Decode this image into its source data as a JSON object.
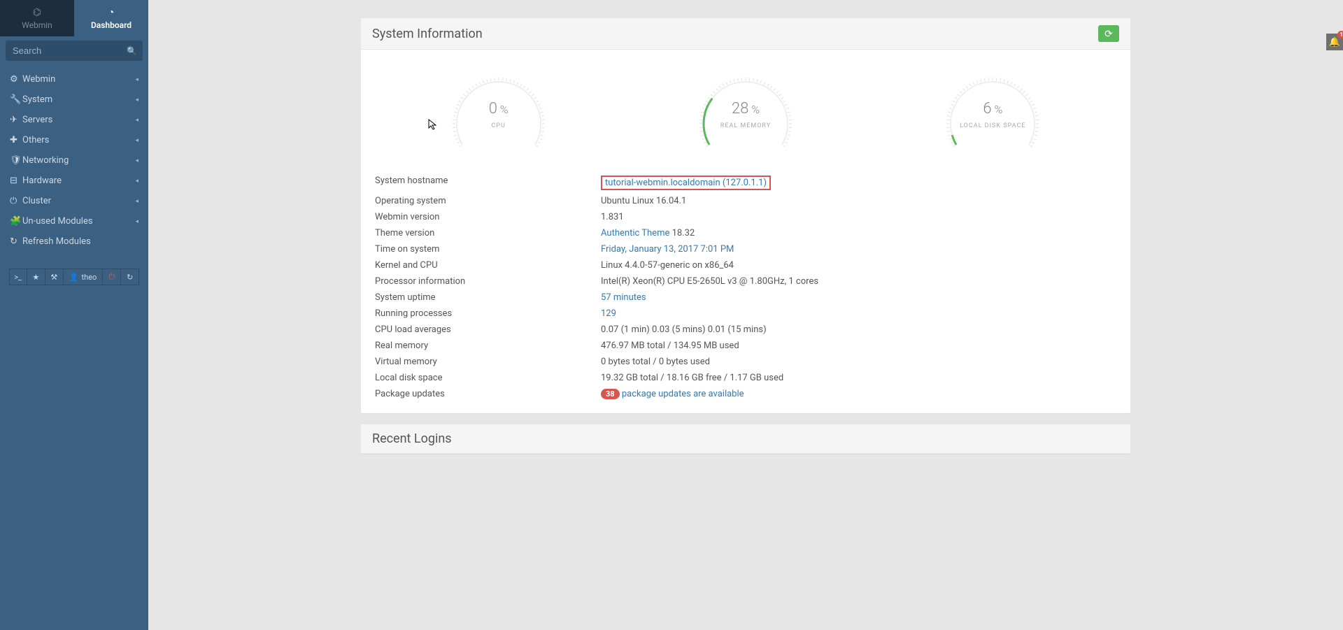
{
  "tabs": {
    "webmin": "Webmin",
    "dashboard": "Dashboard"
  },
  "search": {
    "placeholder": "Search"
  },
  "nav": [
    {
      "icon": "⚙",
      "label": "Webmin"
    },
    {
      "icon": "🔧",
      "label": "System"
    },
    {
      "icon": "✈",
      "label": "Servers"
    },
    {
      "icon": "✚",
      "label": "Others"
    },
    {
      "icon": "🛡",
      "label": "Networking"
    },
    {
      "icon": "⊟",
      "label": "Hardware"
    },
    {
      "icon": "⏻",
      "label": "Cluster"
    },
    {
      "icon": "🧩",
      "label": "Un-used Modules"
    },
    {
      "icon": "↻",
      "label": "Refresh Modules",
      "nocaret": true
    }
  ],
  "bottom": {
    "user": "theo"
  },
  "panels": {
    "sysinfo": {
      "title": "System Information"
    },
    "recent": {
      "title": "Recent Logins"
    }
  },
  "gauges": [
    {
      "value": 0,
      "label": "CPU"
    },
    {
      "value": 28,
      "label": "REAL MEMORY"
    },
    {
      "value": 6,
      "label": "LOCAL DISK SPACE"
    }
  ],
  "info": [
    {
      "label": "System hostname",
      "value": "tutorial-webmin.localdomain (127.0.1.1)",
      "link": true,
      "boxed": true
    },
    {
      "label": "Operating system",
      "value": "Ubuntu Linux 16.04.1"
    },
    {
      "label": "Webmin version",
      "value": "1.831"
    },
    {
      "label": "Theme version",
      "value_link": "Authentic Theme",
      "value_suffix": " 18.32"
    },
    {
      "label": "Time on system",
      "value": "Friday, January 13, 2017 7:01 PM",
      "link": true
    },
    {
      "label": "Kernel and CPU",
      "value": "Linux 4.4.0-57-generic on x86_64"
    },
    {
      "label": "Processor information",
      "value": "Intel(R) Xeon(R) CPU E5-2650L v3 @ 1.80GHz, 1 cores"
    },
    {
      "label": "System uptime",
      "value": "57 minutes",
      "link": true
    },
    {
      "label": "Running processes",
      "value": "129",
      "link": true
    },
    {
      "label": "CPU load averages",
      "value": "0.07 (1 min) 0.03 (5 mins) 0.01 (15 mins)"
    },
    {
      "label": "Real memory",
      "value": "476.97 MB total / 134.95 MB used"
    },
    {
      "label": "Virtual memory",
      "value": "0 bytes total / 0 bytes used"
    },
    {
      "label": "Local disk space",
      "value": "19.32 GB total / 18.16 GB free / 1.17 GB used"
    },
    {
      "label": "Package updates",
      "badge": "38",
      "value": "package updates are available",
      "link": true
    }
  ],
  "notif": {
    "count": "1"
  },
  "chart_data": [
    {
      "type": "gauge",
      "label": "CPU",
      "value": 0,
      "max": 100,
      "unit": "%"
    },
    {
      "type": "gauge",
      "label": "REAL MEMORY",
      "value": 28,
      "max": 100,
      "unit": "%"
    },
    {
      "type": "gauge",
      "label": "LOCAL DISK SPACE",
      "value": 6,
      "max": 100,
      "unit": "%"
    }
  ]
}
